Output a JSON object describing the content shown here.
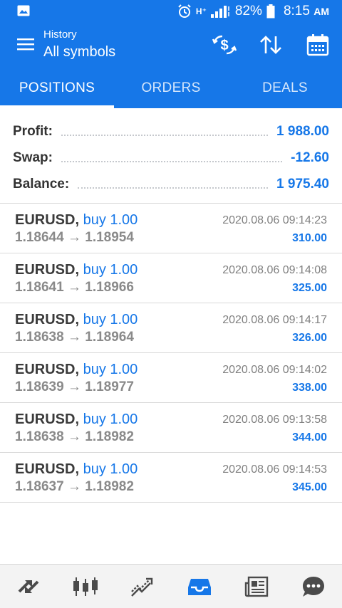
{
  "status_bar": {
    "network": "H⁺",
    "battery": "82%",
    "time": "8:15",
    "ampm": "AM"
  },
  "app_bar": {
    "subtitle": "History",
    "title": "All symbols"
  },
  "tabs": [
    {
      "label": "POSITIONS",
      "active": true
    },
    {
      "label": "ORDERS",
      "active": false
    },
    {
      "label": "DEALS",
      "active": false
    }
  ],
  "summary": {
    "profit_label": "Profit:",
    "profit_value": "1 988.00",
    "swap_label": "Swap:",
    "swap_value": "-12.60",
    "balance_label": "Balance:",
    "balance_value": "1 975.40"
  },
  "positions": [
    {
      "symbol": "EURUSD,",
      "side": "buy 1.00",
      "open": "1.18644",
      "arrow": "→",
      "close": "1.18954",
      "time": "2020.08.06 09:14:23",
      "profit": "310.00"
    },
    {
      "symbol": "EURUSD,",
      "side": "buy 1.00",
      "open": "1.18641",
      "arrow": "→",
      "close": "1.18966",
      "time": "2020.08.06 09:14:08",
      "profit": "325.00"
    },
    {
      "symbol": "EURUSD,",
      "side": "buy 1.00",
      "open": "1.18638",
      "arrow": "→",
      "close": "1.18964",
      "time": "2020.08.06 09:14:17",
      "profit": "326.00"
    },
    {
      "symbol": "EURUSD,",
      "side": "buy 1.00",
      "open": "1.18639",
      "arrow": "→",
      "close": "1.18977",
      "time": "2020.08.06 09:14:02",
      "profit": "338.00"
    },
    {
      "symbol": "EURUSD,",
      "side": "buy 1.00",
      "open": "1.18638",
      "arrow": "→",
      "close": "1.18982",
      "time": "2020.08.06 09:13:58",
      "profit": "344.00"
    },
    {
      "symbol": "EURUSD,",
      "side": "buy 1.00",
      "open": "1.18637",
      "arrow": "→",
      "close": "1.18982",
      "time": "2020.08.06 09:14:53",
      "profit": "345.00"
    }
  ],
  "colors": {
    "accent": "#1677e8",
    "text_dark": "#333333",
    "text_muted": "#8a8a8a",
    "nav_active": "#1677e8",
    "nav_inactive": "#4a4a4a"
  },
  "icons": {
    "gallery": "image-icon",
    "alarm": "alarm-icon",
    "signal": "signal-icon",
    "battery": "battery-icon",
    "menu": "hamburger-menu-icon",
    "currency_exchange": "dollar-exchange-icon",
    "sort": "sort-arrows-icon",
    "calendar": "calendar-icon",
    "nav": [
      "quotes-icon",
      "chart-icon",
      "trade-icon",
      "history-icon",
      "news-icon",
      "messages-icon"
    ]
  }
}
